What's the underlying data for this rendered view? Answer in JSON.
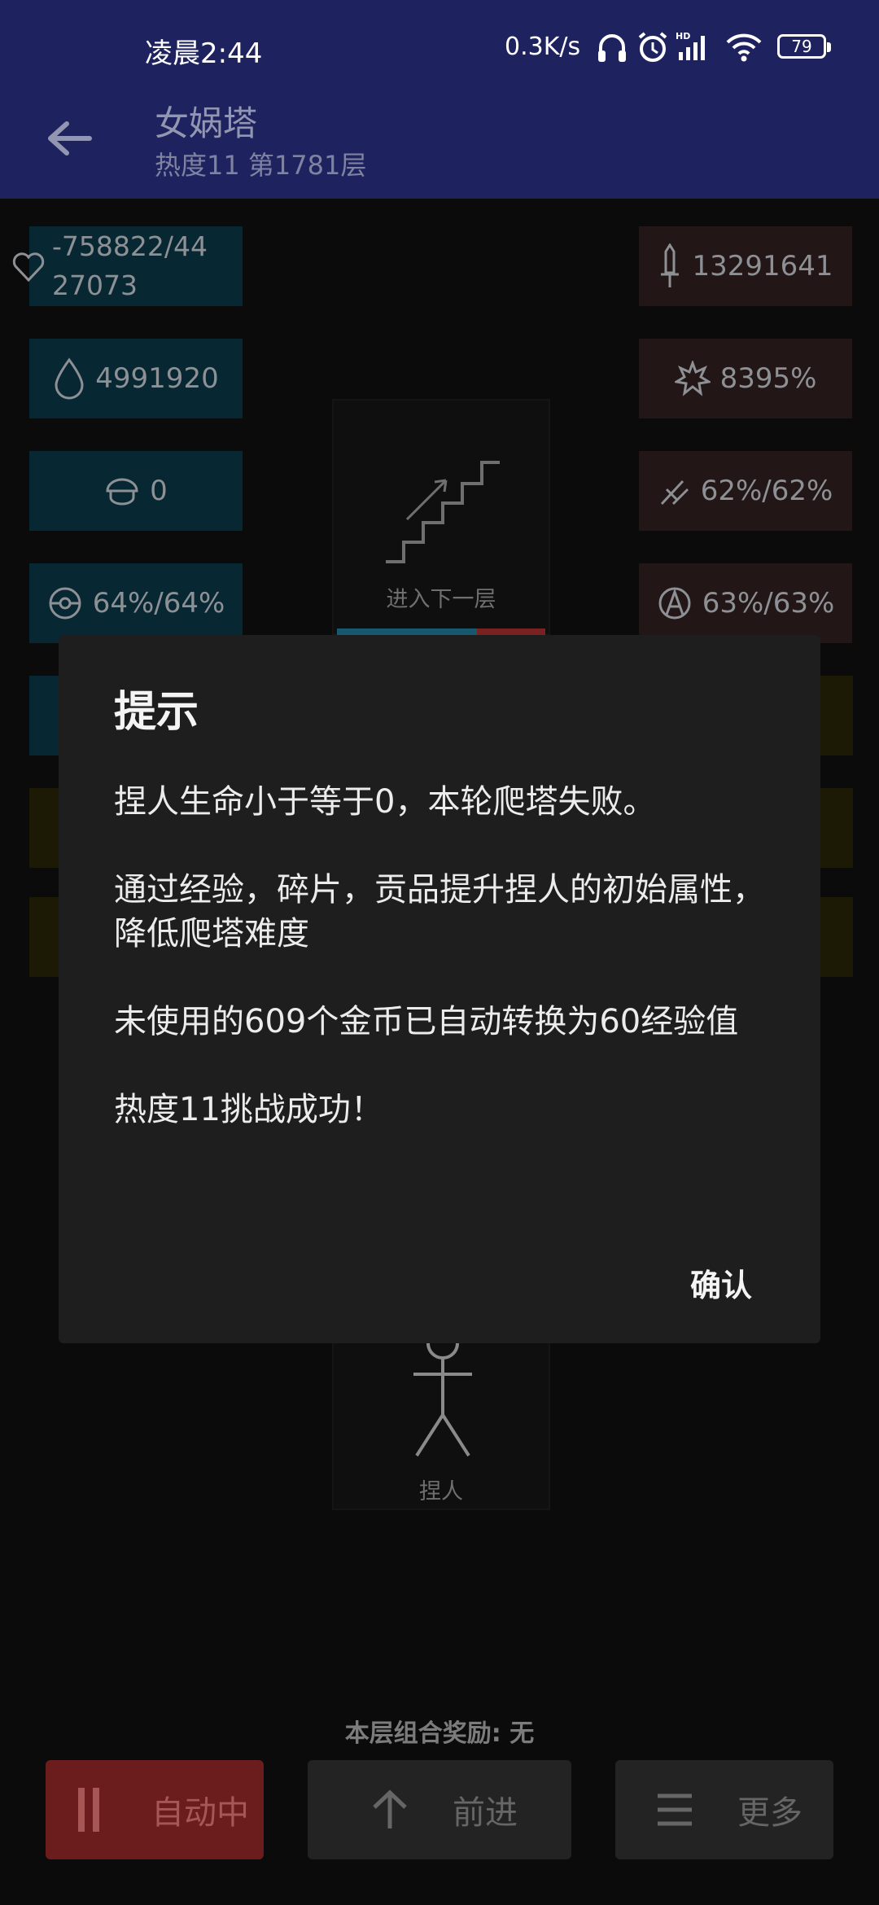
{
  "status_bar": {
    "time": "凌晨2:44",
    "network_speed": "0.3K/s",
    "battery": "79",
    "icons": [
      "headphones-icon",
      "alarm-icon",
      "signal-hd-icon",
      "wifi-icon",
      "battery-icon"
    ]
  },
  "app_bar": {
    "title": "女娲塔",
    "subtitle": "热度11 第1781层",
    "back_icon": "arrow-left-icon"
  },
  "stats_left": [
    {
      "icon": "heart-icon",
      "value": "-758822/4427073"
    },
    {
      "icon": "drop-icon",
      "value": "4991920"
    },
    {
      "icon": "helmet-icon",
      "value": "0"
    },
    {
      "icon": "orb-icon",
      "value": "64%/64%"
    }
  ],
  "stats_right": [
    {
      "icon": "sword-icon",
      "value": "13291641"
    },
    {
      "icon": "burst-icon",
      "value": "8395%"
    },
    {
      "icon": "slash-icon",
      "value": "62%/62%"
    },
    {
      "icon": "pierce-icon",
      "value": "63%/63%"
    }
  ],
  "board": {
    "stairs_label": "进入下一层",
    "person_label": "捏人"
  },
  "dialog": {
    "title": "提示",
    "line1": "捏人生命小于等于0，本轮爬塔失败。",
    "line2": "通过经验，碎片，贡品提升捏人的初始属性，降低爬塔难度",
    "line3": "未使用的609个金币已自动转换为60经验值",
    "line4": "热度11挑战成功！",
    "confirm": "确认"
  },
  "bottom": {
    "reward_text": "本层组合奖励: 无",
    "auto_label": "自动中",
    "forward_label": "前进",
    "more_label": "更多"
  },
  "colors": {
    "app_bar": "#1e2360",
    "dialog_bg": "#1e1e1e",
    "auto_button": "#6a1d1c",
    "tile_left": "#072733",
    "tile_right": "#221616"
  }
}
